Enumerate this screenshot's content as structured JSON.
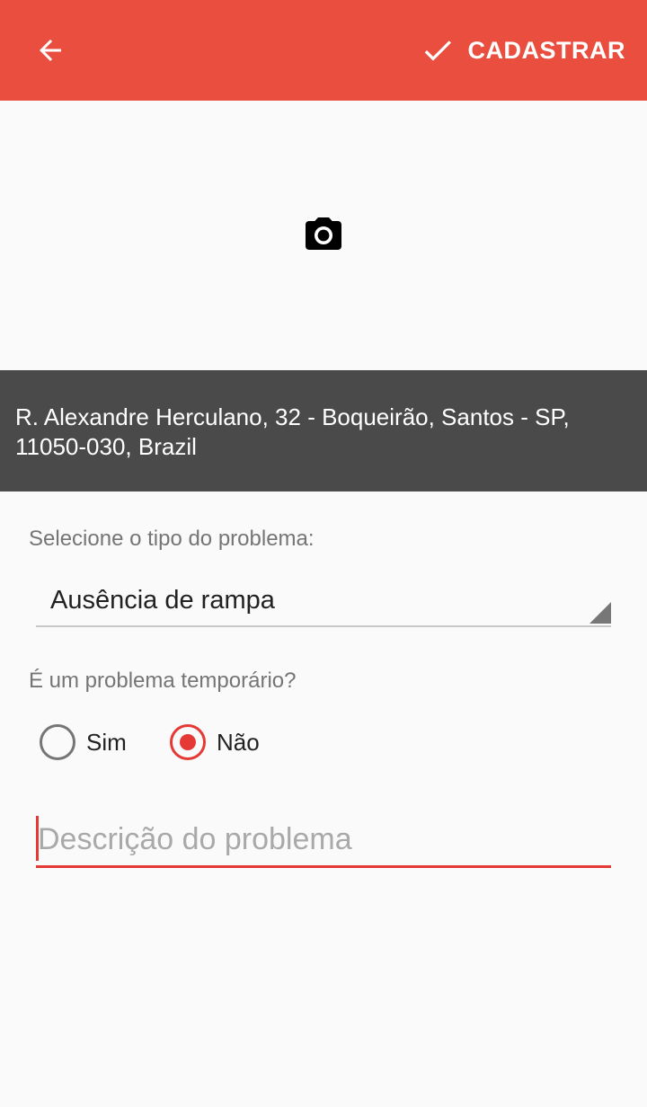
{
  "toolbar": {
    "back_icon": "arrow-back-icon",
    "save_icon": "check-icon",
    "save_label": "CADASTRAR",
    "color": "#e94e3f"
  },
  "photo": {
    "icon": "camera-icon"
  },
  "address": {
    "line1": "R. Alexandre Herculano, 32 - Boqueirão, Santos - SP,",
    "line2": "11050-030, Brazil"
  },
  "form": {
    "problem_type_label": "Selecione o tipo do problema:",
    "problem_type_value": "Ausência de rampa",
    "temporary_label": "É um problema temporário?",
    "options": [
      {
        "label": "Sim",
        "checked": false
      },
      {
        "label": "Não",
        "checked": true
      }
    ],
    "description_placeholder": "Descrição do problema",
    "description_value": "",
    "accent": "#e53935"
  }
}
